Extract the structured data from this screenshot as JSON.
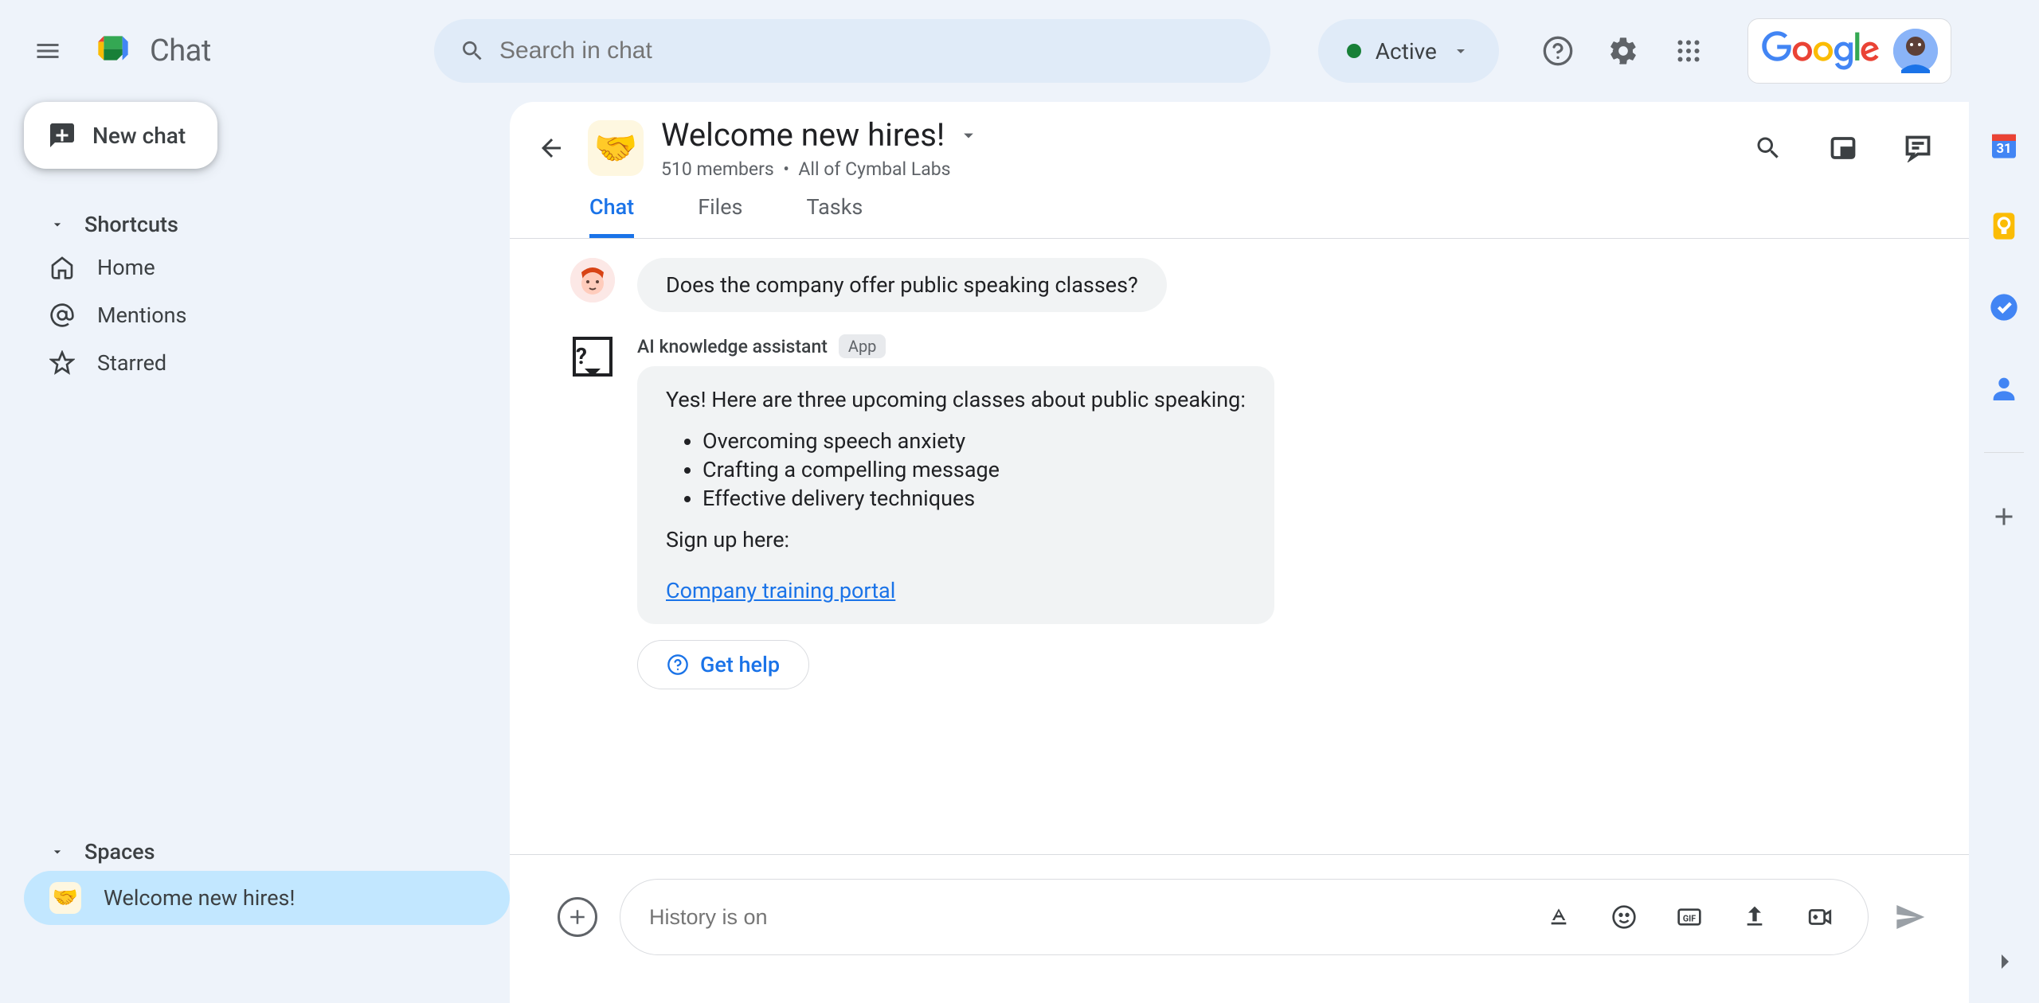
{
  "brand": {
    "title": "Chat"
  },
  "search": {
    "placeholder": "Search in chat"
  },
  "status": {
    "label": "Active"
  },
  "google": {
    "label": "Google"
  },
  "new_chat": {
    "label": "New chat"
  },
  "nav": {
    "shortcuts_header": "Shortcuts",
    "home": "Home",
    "mentions": "Mentions",
    "starred": "Starred",
    "spaces_header": "Spaces",
    "space_1": "Welcome new hires!"
  },
  "space": {
    "title": "Welcome new hires!",
    "members": "510 members",
    "org": "All of Cymbal Labs"
  },
  "tabs": {
    "chat": "Chat",
    "files": "Files",
    "tasks": "Tasks"
  },
  "messages": {
    "user_text": "Does the company offer public speaking classes?",
    "bot_sender": "AI knowledge assistant",
    "bot_badge": "App",
    "bot_intro": "Yes! Here are three upcoming classes about public speaking:",
    "bot_item_1": "Overcoming speech anxiety",
    "bot_item_2": "Crafting a compelling message",
    "bot_item_3": "Effective delivery techniques",
    "bot_signup": "Sign up here:",
    "bot_link": "Company training portal",
    "get_help": "Get help"
  },
  "composer": {
    "placeholder": "History is on"
  }
}
